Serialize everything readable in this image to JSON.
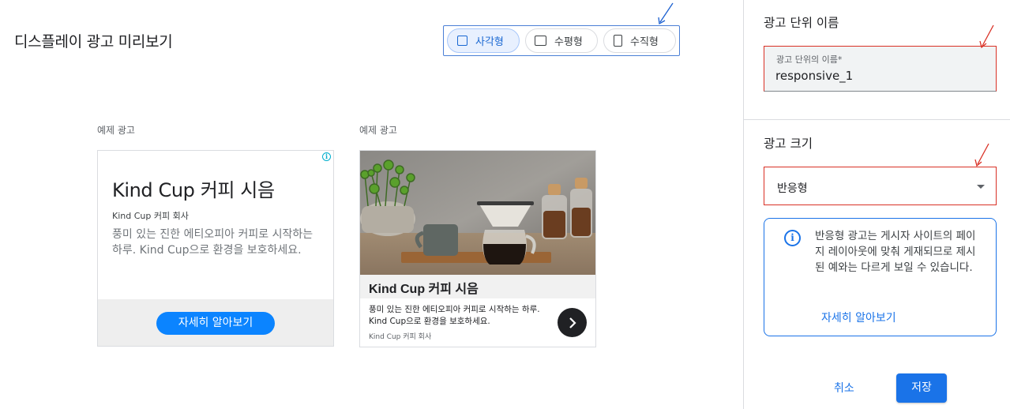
{
  "preview": {
    "title": "디스플레이 광고 미리보기",
    "shape_options": [
      {
        "label": "사각형",
        "icon": "square-icon",
        "selected": true
      },
      {
        "label": "수평형",
        "icon": "horizontal-rect-icon",
        "selected": false
      },
      {
        "label": "수직형",
        "icon": "vertical-rect-icon",
        "selected": false
      }
    ]
  },
  "ads": [
    {
      "label": "예제 광고",
      "headline": "Kind Cup 커피 시음",
      "company": "Kind Cup 커피 회사",
      "description": "풍미 있는 진한 에티오피아 커피로 시작하는 하루. Kind Cup으로 환경을 보호하세요.",
      "cta": "자세히 알아보기",
      "info_icon": "adchoices-info-icon"
    },
    {
      "label": "예제 광고",
      "headline": "Kind Cup 커피 시음",
      "description": "풍미 있는 진한 에티오피아 커피로 시작하는 하루. Kind Cup으로 환경을 보호하세요.",
      "company": "Kind Cup 커피 회사",
      "next_icon": "chevron-right-icon"
    }
  ],
  "panel": {
    "ad_unit_name": {
      "section_title": "광고 단위 이름",
      "field_label": "광고 단위의 이름*",
      "field_value": "responsive_1"
    },
    "ad_size": {
      "section_title": "광고 크기",
      "selected": "반응형"
    },
    "info": {
      "text": "반응형 광고는 게시자 사이트의 페이지 레이아웃에 맞춰 게재되므로 제시된 예와는 다르게 보일 수 있습니다.",
      "link": "자세히 알아보기"
    },
    "actions": {
      "cancel": "취소",
      "save": "저장"
    }
  },
  "colors": {
    "accent": "#1a73e8",
    "error_outline": "#d93025",
    "cta_blue": "#0b84ff",
    "annotation_blue": "#1a5fd0",
    "annotation_red": "#d93025"
  }
}
